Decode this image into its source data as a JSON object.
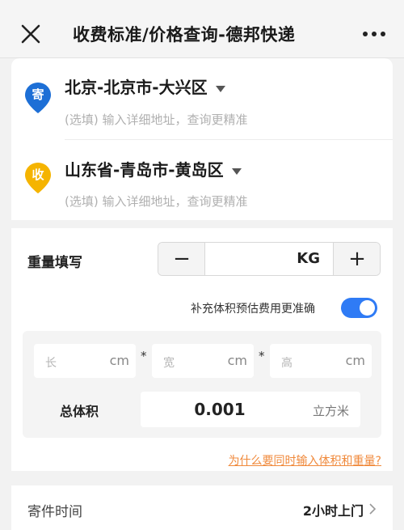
{
  "header": {
    "title": "收费标准/价格查询-德邦快递",
    "close_icon": "close-icon",
    "more_icon": "more-icon"
  },
  "sender": {
    "badge": "寄",
    "badge_color": "#1d6fd6",
    "address": "北京-北京市-大兴区",
    "detail_placeholder": "(选填) 输入详细地址，查询更精准"
  },
  "receiver": {
    "badge": "收",
    "badge_color": "#f5b400",
    "address": "山东省-青岛市-黄岛区",
    "detail_placeholder": "(选填) 输入详细地址，查询更精准"
  },
  "weight": {
    "label": "重量填写",
    "minus": "−",
    "plus": "+",
    "unit": "KG"
  },
  "volume": {
    "toggle_label": "补充体积预估费用更准确",
    "toggle_on": true,
    "toggle_color": "#2f7bf5",
    "length_placeholder": "长",
    "width_placeholder": "宽",
    "height_placeholder": "高",
    "dim_unit": "cm",
    "multiply": "*",
    "total_label": "总体积",
    "total_value": "0.001",
    "total_unit": "立方米"
  },
  "help_link": "为什么要同时输入体积和重量?",
  "pickup": {
    "label": "寄件时间",
    "value": "2小时上门"
  }
}
